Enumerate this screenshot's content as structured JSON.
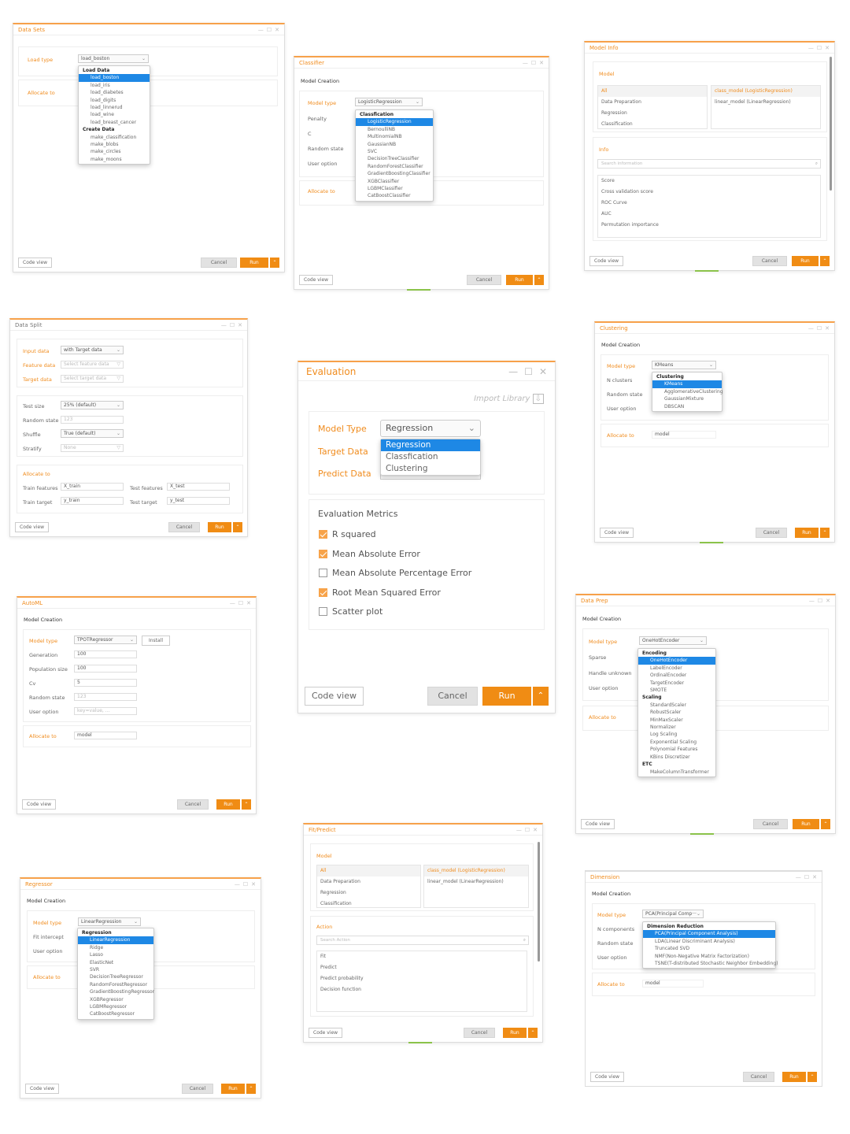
{
  "colors": {
    "accent": "#f08c1e",
    "selection": "#1e88e5",
    "run": "#f08c14"
  },
  "common": {
    "code_view": "Code view",
    "cancel": "Cancel",
    "run": "Run",
    "arrow": "⌃",
    "model_creation": "Model Creation",
    "allocate_to": "Allocate to",
    "user_option": "User option",
    "random_state": "Random state",
    "model_type": "Model type"
  },
  "data_sets": {
    "title": "Data Sets",
    "load_type_label": "Load type",
    "load_type_value": "load_boston",
    "allocate_label": "Allocate to",
    "dropdown": [
      {
        "group": "Load Data"
      },
      {
        "item": "load_boston",
        "selected": true
      },
      {
        "item": "load_iris"
      },
      {
        "item": "load_diabetes"
      },
      {
        "item": "load_digits"
      },
      {
        "item": "load_linnerud"
      },
      {
        "item": "load_wine"
      },
      {
        "item": "load_breast_cancer"
      },
      {
        "group": "Create Data"
      },
      {
        "item": "make_classification"
      },
      {
        "item": "make_blobs"
      },
      {
        "item": "make_circles"
      },
      {
        "item": "make_moons"
      }
    ]
  },
  "classifier": {
    "title": "Classifier",
    "model_type_value": "LogisticRegression",
    "penalty": "Penalty",
    "c": "C",
    "dropdown": [
      {
        "group": "Classfication"
      },
      {
        "item": "LogisticRegression",
        "selected": true
      },
      {
        "item": "BernoulliNB"
      },
      {
        "item": "MultinomialNB"
      },
      {
        "item": "GaussianNB"
      },
      {
        "item": "SVC"
      },
      {
        "item": "DecisionTreeClassifier"
      },
      {
        "item": "RandomForestClassifier"
      },
      {
        "item": "GradientBoostingClassifier"
      },
      {
        "item": "XGBClassifier"
      },
      {
        "item": "LGBMClassifier"
      },
      {
        "item": "CatBoostClassifier"
      }
    ]
  },
  "model_info": {
    "title": "Model Info",
    "model_heading": "Model",
    "categories": [
      "All",
      "Data Preparation",
      "Regression",
      "Classification"
    ],
    "models": [
      "class_model (LogisticRegression)",
      "linear_model (LinearRegression)"
    ],
    "info_heading": "Info",
    "search_placeholder": "Search information",
    "info_items": [
      "Score",
      "Cross validation score",
      "ROC Curve",
      "AUC",
      "Permutation importance"
    ]
  },
  "data_split": {
    "title": "Data Split",
    "input_data": "Input data",
    "input_value": "with Target data",
    "feature_data": "Feature data",
    "feature_placeholder": "Select feature data",
    "target_data": "Target data",
    "target_placeholder": "Select target data",
    "test_size": "Test size",
    "test_size_value": "25% (default)",
    "random_state_value": "123",
    "shuffle": "Shuffle",
    "shuffle_value": "True (default)",
    "stratify": "Stratify",
    "stratify_value": "None",
    "train_features": "Train features",
    "train_features_value": "X_train",
    "test_features": "Test features",
    "test_features_value": "X_test",
    "train_target": "Train target",
    "train_target_value": "y_train",
    "test_target": "Test target",
    "test_target_value": "y_test"
  },
  "evaluation": {
    "title": "Evaluation",
    "import_library": "Import Library",
    "model_type_label": "Model Type",
    "model_type_value": "Regression",
    "target_label": "Target Data",
    "predict_label": "Predict Data",
    "predict_value": "pred",
    "dropdown": [
      {
        "item": "Regression",
        "selected": true
      },
      {
        "item": "Classfication"
      },
      {
        "item": "Clustering"
      }
    ],
    "metrics_heading": "Evaluation Metrics",
    "metrics": [
      {
        "label": "R squared",
        "checked": true
      },
      {
        "label": "Mean Absolute Error",
        "checked": true
      },
      {
        "label": "Mean Absolute Percentage Error",
        "checked": false
      },
      {
        "label": "Root Mean Squared Error",
        "checked": true
      },
      {
        "label": "Scatter plot",
        "checked": false
      }
    ]
  },
  "clustering": {
    "title": "Clustering",
    "model_type_value": "KMeans",
    "n_clusters": "N clusters",
    "allocate_value": "model",
    "dropdown": [
      {
        "group": "Clustering"
      },
      {
        "item": "KMeans",
        "selected": true
      },
      {
        "item": "AgglomerativeClustering"
      },
      {
        "item": "GaussianMixture"
      },
      {
        "item": "DBSCAN"
      }
    ]
  },
  "automl": {
    "title": "AutoML",
    "model_type_value": "TPOTRegressor",
    "install": "Install",
    "generation": "Generation",
    "generation_value": "100",
    "population": "Population size",
    "population_value": "100",
    "cv": "Cv",
    "cv_value": "5",
    "random_state_value": "123",
    "user_option_placeholder": "key=value, ...",
    "allocate_value": "model"
  },
  "data_prep": {
    "title": "Data Prep",
    "model_type_value": "OneHotEncoder",
    "sparse": "Sparse",
    "handle_unknown": "Handle unknown",
    "dropdown": [
      {
        "group": "Encoding"
      },
      {
        "item": "OneHotEncoder",
        "selected": true
      },
      {
        "item": "LabelEncoder"
      },
      {
        "item": "OrdinalEncoder"
      },
      {
        "item": "TargetEncoder"
      },
      {
        "item": "SMOTE"
      },
      {
        "group": "Scaling"
      },
      {
        "item": "StandardScaler"
      },
      {
        "item": "RobustScaler"
      },
      {
        "item": "MinMaxScaler"
      },
      {
        "item": "Normalizer"
      },
      {
        "item": "Log Scaling"
      },
      {
        "item": "Exponential Scaling"
      },
      {
        "item": "Polynomial Features"
      },
      {
        "item": "KBins Discretizer"
      },
      {
        "group": "ETC"
      },
      {
        "item": "MakeColumnTransformer"
      }
    ]
  },
  "fit_predict": {
    "title": "Fit/Predict",
    "model_heading": "Model",
    "categories": [
      "All",
      "Data Preparation",
      "Regression",
      "Classification"
    ],
    "models": [
      "class_model (LogisticRegression)",
      "linear_model (LinearRegression)"
    ],
    "action_heading": "Action",
    "search_placeholder": "Search Action",
    "actions": [
      "Fit",
      "Predict",
      "Predict probability",
      "Decision function"
    ]
  },
  "regressor": {
    "title": "Regressor",
    "model_type_value": "LinearRegression",
    "fit_intercept": "Fit intercept",
    "dropdown": [
      {
        "group": "Regression"
      },
      {
        "item": "LinearRegression",
        "selected": true
      },
      {
        "item": "Ridge"
      },
      {
        "item": "Lasso"
      },
      {
        "item": "ElasticNet"
      },
      {
        "item": "SVR"
      },
      {
        "item": "DecisionTreeRegressor"
      },
      {
        "item": "RandomForestRegressor"
      },
      {
        "item": "GradientBoostingRegressor"
      },
      {
        "item": "XGBRegressor"
      },
      {
        "item": "LGBMRegressor"
      },
      {
        "item": "CatBoostRegressor"
      }
    ]
  },
  "dimension": {
    "title": "Dimension",
    "model_type_value": "PCA(Principal Comp···",
    "n_components": "N components",
    "allocate_value": "model",
    "dropdown": [
      {
        "group": "Dimension Reduction"
      },
      {
        "item": "PCA(Principal Component Analysis)",
        "selected": true
      },
      {
        "item": "LDA(Linear Discriminant Analysis)"
      },
      {
        "item": "Truncated SVD"
      },
      {
        "item": "NMF(Non-Negative Matrix Factorization)"
      },
      {
        "item": "TSNE(T-distributed Stochastic Neighbor Embedding)"
      }
    ]
  }
}
